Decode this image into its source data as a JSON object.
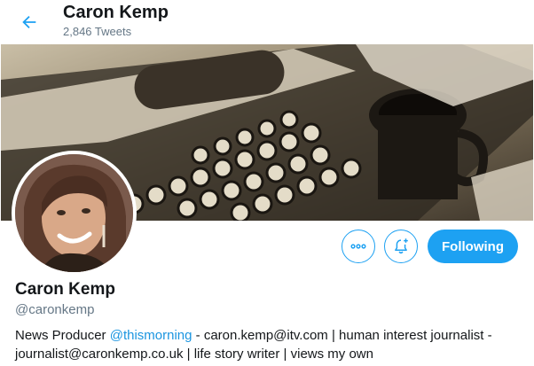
{
  "header": {
    "name": "Caron Kemp",
    "tweet_count": "2,846 Tweets",
    "back_icon": "arrow-left-icon"
  },
  "profile": {
    "name": "Caron Kemp",
    "handle": "@caronkemp",
    "bio": {
      "part1": "News Producer ",
      "mention": "@thismorning",
      "part2": " - caron.kemp@itv.com | human interest journalist - journalist@caronkemp.co.uk | life story writer | views my own"
    }
  },
  "actions": {
    "more_icon": "more-horizontal-icon",
    "notify_icon": "bell-plus-icon",
    "follow_label": "Following"
  },
  "colors": {
    "accent": "#1da1f2",
    "mention": "#1b95e0",
    "secondary_text": "#657786"
  }
}
